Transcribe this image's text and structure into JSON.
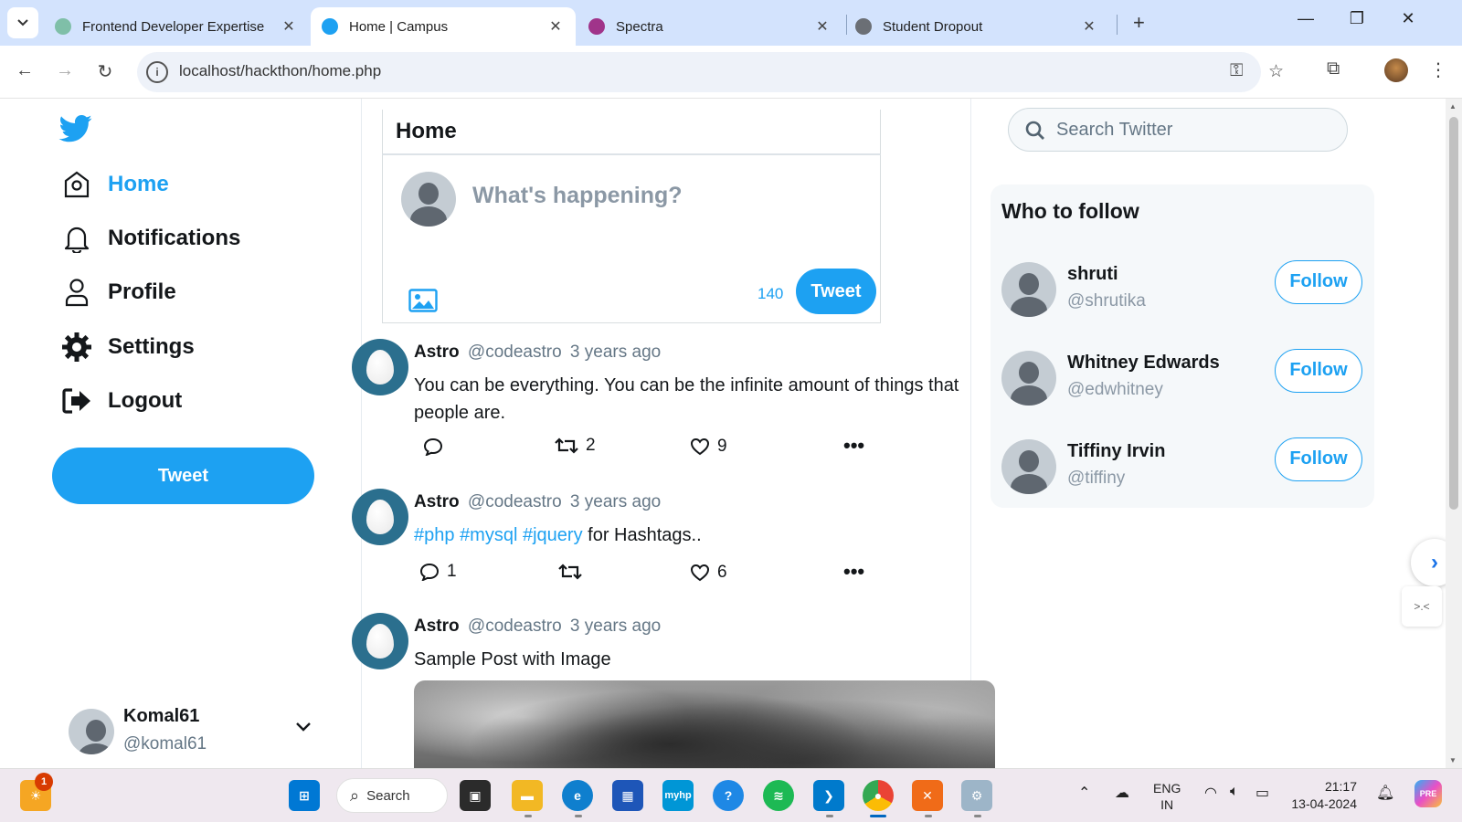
{
  "browser": {
    "tabs": [
      {
        "title": "Frontend Developer Expertise",
        "active": false
      },
      {
        "title": "Home | Campus",
        "active": true
      },
      {
        "title": "Spectra",
        "active": false
      },
      {
        "title": "Student Dropout",
        "active": false
      }
    ],
    "url": "localhost/hackthon/home.php"
  },
  "sidebar": {
    "nav": [
      {
        "label": "Home",
        "icon": "home-icon",
        "active": true
      },
      {
        "label": "Notifications",
        "icon": "bell-icon",
        "active": false
      },
      {
        "label": "Profile",
        "icon": "user-icon",
        "active": false
      },
      {
        "label": "Settings",
        "icon": "gear-icon",
        "active": false
      },
      {
        "label": "Logout",
        "icon": "logout-icon",
        "active": false
      }
    ],
    "tweet_label": "Tweet",
    "user": {
      "name": "Komal61",
      "handle": "@komal61"
    }
  },
  "feed": {
    "title": "Home",
    "composer": {
      "placeholder": "What's happening?",
      "count": "140",
      "tweet_label": "Tweet"
    },
    "posts": [
      {
        "name": "Astro",
        "handle": "@codeastro",
        "time": "3 years ago",
        "text": "You can be everything. You can be the infinite amount of things that people are.",
        "replies": "",
        "retweets": "2",
        "likes": "9"
      },
      {
        "name": "Astro",
        "handle": "@codeastro",
        "time": "3 years ago",
        "tags": [
          "#php",
          "#mysql",
          "#jquery"
        ],
        "text_after": "for Hashtags..",
        "replies": "1",
        "retweets": "",
        "likes": "6"
      },
      {
        "name": "Astro",
        "handle": "@codeastro",
        "time": "3 years ago",
        "text": "Sample Post with Image"
      }
    ]
  },
  "right": {
    "search_placeholder": "Search Twitter",
    "who_to_follow": {
      "title": "Who to follow",
      "users": [
        {
          "name": "shruti",
          "handle": "@shrutika",
          "button": "Follow"
        },
        {
          "name": "Whitney Edwards",
          "handle": "@edwhitney",
          "button": "Follow"
        },
        {
          "name": "Tiffiny Irvin",
          "handle": "@tiffiny",
          "button": "Follow"
        }
      ]
    }
  },
  "taskbar": {
    "search_label": "Search",
    "notification_badge": "1",
    "lang_line1": "ENG",
    "lang_line2": "IN",
    "time": "21:17",
    "date": "13-04-2024"
  },
  "colors": {
    "accent": "#1da1f2",
    "chrome_tab_bg": "#d3e3fd"
  }
}
